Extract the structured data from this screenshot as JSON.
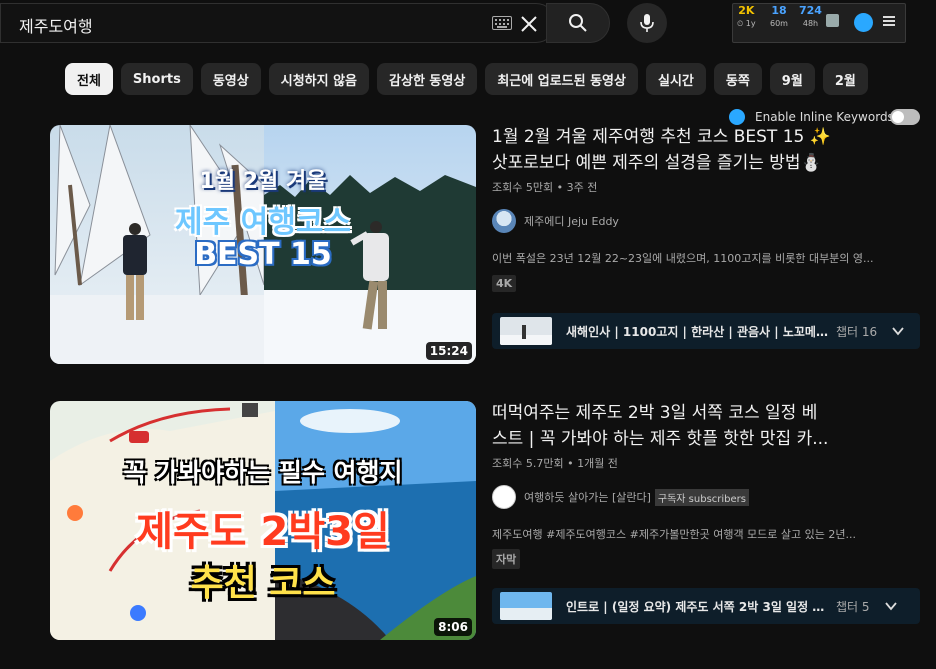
{
  "search": {
    "query": "제주도여행"
  },
  "extension": {
    "stats": [
      {
        "value": "2K",
        "sub": "⏲ 1y",
        "color": "#f2c200"
      },
      {
        "value": "18",
        "sub": "60m",
        "color": "#4aa3ff"
      },
      {
        "value": "724",
        "sub": "48h",
        "color": "#4aa3ff"
      }
    ],
    "inline_keywords_label": "Enable Inline Keywords"
  },
  "chips": [
    "전체",
    "Shorts",
    "동영상",
    "시청하지 않음",
    "감상한 동영상",
    "최근에 업로드된 동영상",
    "실시간",
    "동쪽",
    "9월",
    "2월"
  ],
  "videos": [
    {
      "title_line1": "1월 2월 겨울 제주여행 추천 코스 BEST 15 ✨",
      "title_line2": "삿포로보다 예쁜 제주의 설경을 즐기는 방법⛄",
      "meta": "조회수 5만회 • 3주 전",
      "channel": "제주에디 Jeju Eddy",
      "description": "이번 폭설은 23년 12월 22~23일에 내렸으며, 1100고지를 비롯한 대부분의 영...",
      "badge": "4K",
      "chapter_text": "새해인사 | 1100고지 | 한라산 | 관음사 | 노꼬메...",
      "chapter_count": "챕터 16",
      "duration": "15:24",
      "thumb_lines": [
        "1월 2월 겨울",
        "제주 여행코스",
        "BEST 15"
      ]
    },
    {
      "title_line1": "떠먹여주는 제주도 2박 3일 서쪽 코스 일정 베",
      "title_line2": "스트 | 꼭 가봐야 하는 제주 핫플 핫한 맛집 카...",
      "meta": "조회수 5.7만회 • 1개월 전",
      "channel": "여행하듯 살아가는 [살란다]",
      "channel_badge": "구독자 subscribers",
      "description": "제주도여행 #제주도여행코스 #제주가볼만한곳 여행객 모드로 살고 있는 2년...",
      "badge": "자막",
      "chapter_text": "인트로 | (일정 요약) 제주도 서쪽 2박 3일 일정 |...",
      "chapter_count": "챕터 5",
      "duration": "8:06",
      "thumb_lines": [
        "꼭 가봐야하는  필수 여행지",
        "제주도 2박3일",
        "추천 코스"
      ]
    }
  ]
}
